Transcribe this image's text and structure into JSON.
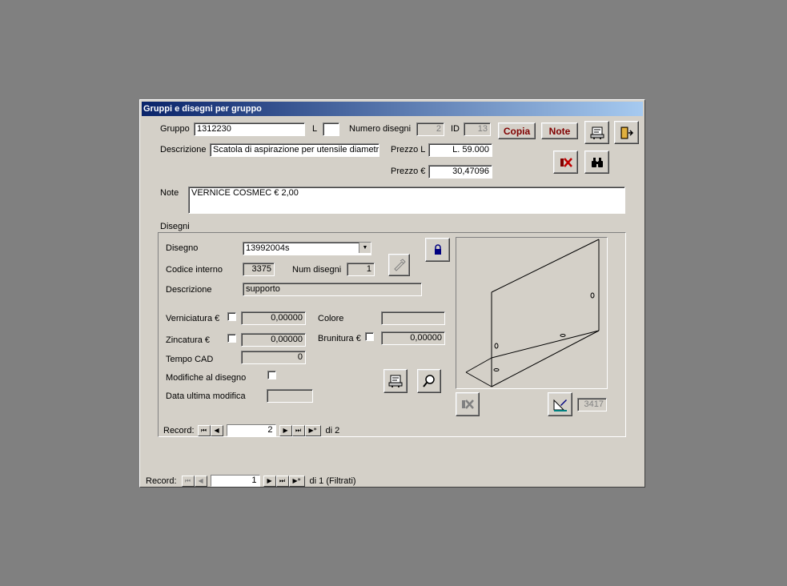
{
  "window": {
    "title": "Gruppi e disegni per gruppo"
  },
  "header": {
    "gruppo_label": "Gruppo",
    "gruppo_value": "1312230",
    "l_label": "L",
    "l_value": "",
    "numero_disegni_label": "Numero disegni",
    "numero_disegni_value": "2",
    "id_label": "ID",
    "id_value": "13",
    "descrizione_label": "Descrizione",
    "descrizione_value": "Scatola di aspirazione per utensile diametro",
    "prezzo_l_label": "Prezzo L",
    "prezzo_l_value": "L. 59.000",
    "prezzo_eur_label": "Prezzo €",
    "prezzo_eur_value": "30,47096",
    "note_label": "Note",
    "note_value": "VERNICE COSMEC € 2,00"
  },
  "buttons": {
    "copia": "Copia",
    "note": "Note"
  },
  "disegni": {
    "section_label": "Disegni",
    "disegno_label": "Disegno",
    "disegno_value": "13992004s",
    "codice_interno_label": "Codice interno",
    "codice_interno_value": "3375",
    "num_disegni_label": "Num disegni",
    "num_disegni_value": "1",
    "descrizione_label": "Descrizione",
    "descrizione_value": "supporto",
    "verniciatura_label": "Verniciatura €",
    "verniciatura_value": "0,00000",
    "colore_label": "Colore",
    "colore_value": "",
    "zincatura_label": "Zincatura €",
    "zincatura_value": "0,00000",
    "brunitura_label": "Brunitura €",
    "brunitura_value": "0,00000",
    "tempo_cad_label": "Tempo CAD",
    "tempo_cad_value": "0",
    "modifiche_label": "Modifiche al disegno",
    "data_modifica_label": "Data ultima modifica",
    "data_modifica_value": "",
    "image_id_value": "3417"
  },
  "subnav": {
    "label": "Record:",
    "value": "2",
    "of_text": "di 2"
  },
  "mainnav": {
    "label": "Record:",
    "value": "1",
    "of_text": "di 1 (Filtrati)"
  },
  "colors": {
    "titlebar_start": "#0a246a",
    "titlebar_end": "#a6caf0",
    "face": "#d4d0c8",
    "accent_text": "#800000"
  }
}
